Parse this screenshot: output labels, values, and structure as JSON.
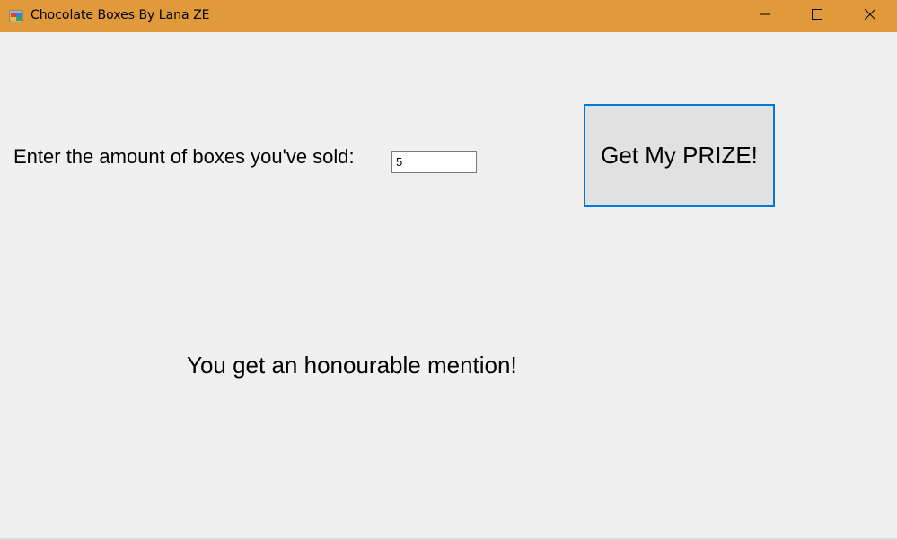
{
  "window": {
    "title": "Chocolate Boxes By Lana ZE",
    "titlebar_color": "#e09a3a",
    "icon": "app-window-icon",
    "controls": [
      "minimize-icon",
      "maximize-icon",
      "close-icon"
    ]
  },
  "form": {
    "prompt_label": "Enter the amount of boxes you've sold:",
    "boxes_input_value": "5",
    "prize_button_label": "Get My PRIZE!",
    "prize_button_border_color": "#0078d7",
    "result_label": "You get an honourable mention!"
  }
}
